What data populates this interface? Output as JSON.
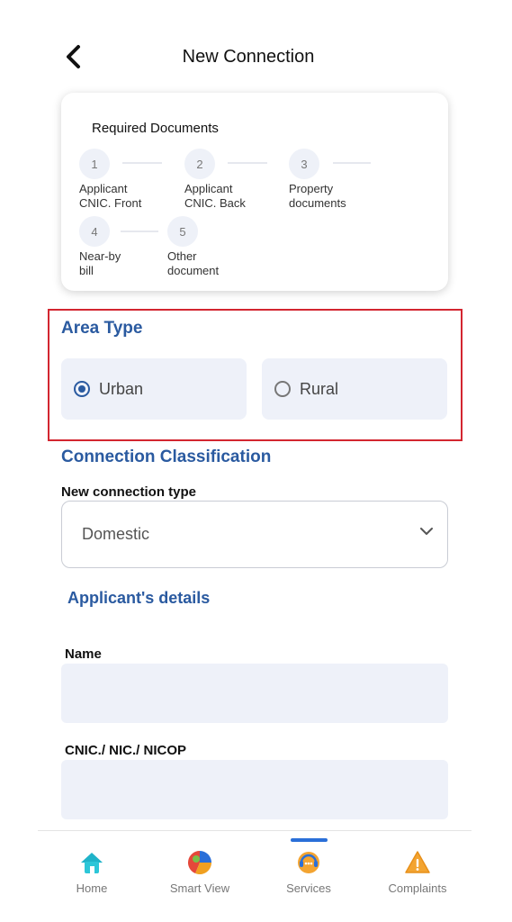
{
  "header": {
    "title": "New Connection"
  },
  "required_documents": {
    "title": "Required Documents",
    "steps": [
      {
        "number": "1",
        "label_line1": "Applicant",
        "label_line2": "CNIC. Front"
      },
      {
        "number": "2",
        "label_line1": "Applicant",
        "label_line2": "CNIC. Back"
      },
      {
        "number": "3",
        "label_line1": "Property",
        "label_line2": "documents"
      },
      {
        "number": "4",
        "label_line1": "Near-by",
        "label_line2": "bill"
      },
      {
        "number": "5",
        "label_line1": "Other",
        "label_line2": "document"
      }
    ]
  },
  "area_type": {
    "title": "Area Type",
    "options": [
      {
        "label": "Urban",
        "selected": true
      },
      {
        "label": "Rural",
        "selected": false
      }
    ]
  },
  "connection_classification": {
    "title": "Connection Classification",
    "type_label": "New connection type",
    "type_value": "Domestic"
  },
  "applicant_details": {
    "title": "Applicant's details",
    "name_label": "Name",
    "name_value": "",
    "cnic_label": "CNIC./ NIC./ NICOP",
    "cnic_value": ""
  },
  "bottom_nav": {
    "items": [
      {
        "label": "Home",
        "icon": "home-icon"
      },
      {
        "label": "Smart View",
        "icon": "pie-chart-icon"
      },
      {
        "label": "Services",
        "icon": "support-agent-icon",
        "active": true
      },
      {
        "label": "Complaints",
        "icon": "warning-icon"
      }
    ]
  },
  "colors": {
    "accent": "#2a5aa0",
    "highlight_border": "#d32630",
    "active_tab": "#2a6fd8"
  }
}
